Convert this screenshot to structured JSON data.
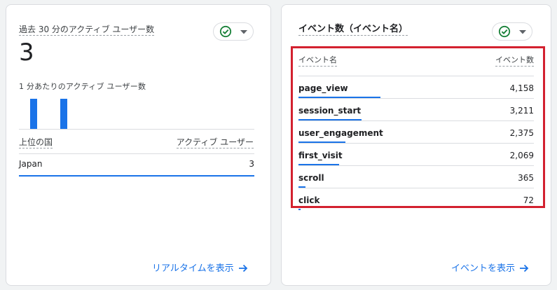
{
  "colors": {
    "accent": "#1a73e8",
    "highlight": "#d3212f",
    "success": "#188038"
  },
  "left_card": {
    "title": "過去 30 分のアクティブ ユーザー数",
    "active_users": "3",
    "per_minute_title": "1 分あたりのアクティブ ユーザー数",
    "per_minute_bars": [
      1,
      1
    ],
    "table": {
      "col_location": "上位の国",
      "col_users": "アクティブ ユーザー",
      "rows": [
        {
          "country": "Japan",
          "users": "3",
          "share": 1.0
        }
      ]
    },
    "footer_link": "リアルタイムを表示",
    "status_icon": "check-circle-icon",
    "dropdown_icon": "caret-down-icon"
  },
  "right_card": {
    "title": "イベント数（イベント名）",
    "table": {
      "col_event": "イベント名",
      "col_count": "イベント数",
      "rows": [
        {
          "event": "page_view",
          "count": "4,158",
          "value": 4158
        },
        {
          "event": "session_start",
          "count": "3,211",
          "value": 3211
        },
        {
          "event": "user_engagement",
          "count": "2,375",
          "value": 2375
        },
        {
          "event": "first_visit",
          "count": "2,069",
          "value": 2069
        },
        {
          "event": "scroll",
          "count": "365",
          "value": 365
        },
        {
          "event": "click",
          "count": "72",
          "value": 72
        }
      ]
    },
    "footer_link": "イベントを表示",
    "status_icon": "check-circle-icon",
    "dropdown_icon": "caret-down-icon"
  }
}
